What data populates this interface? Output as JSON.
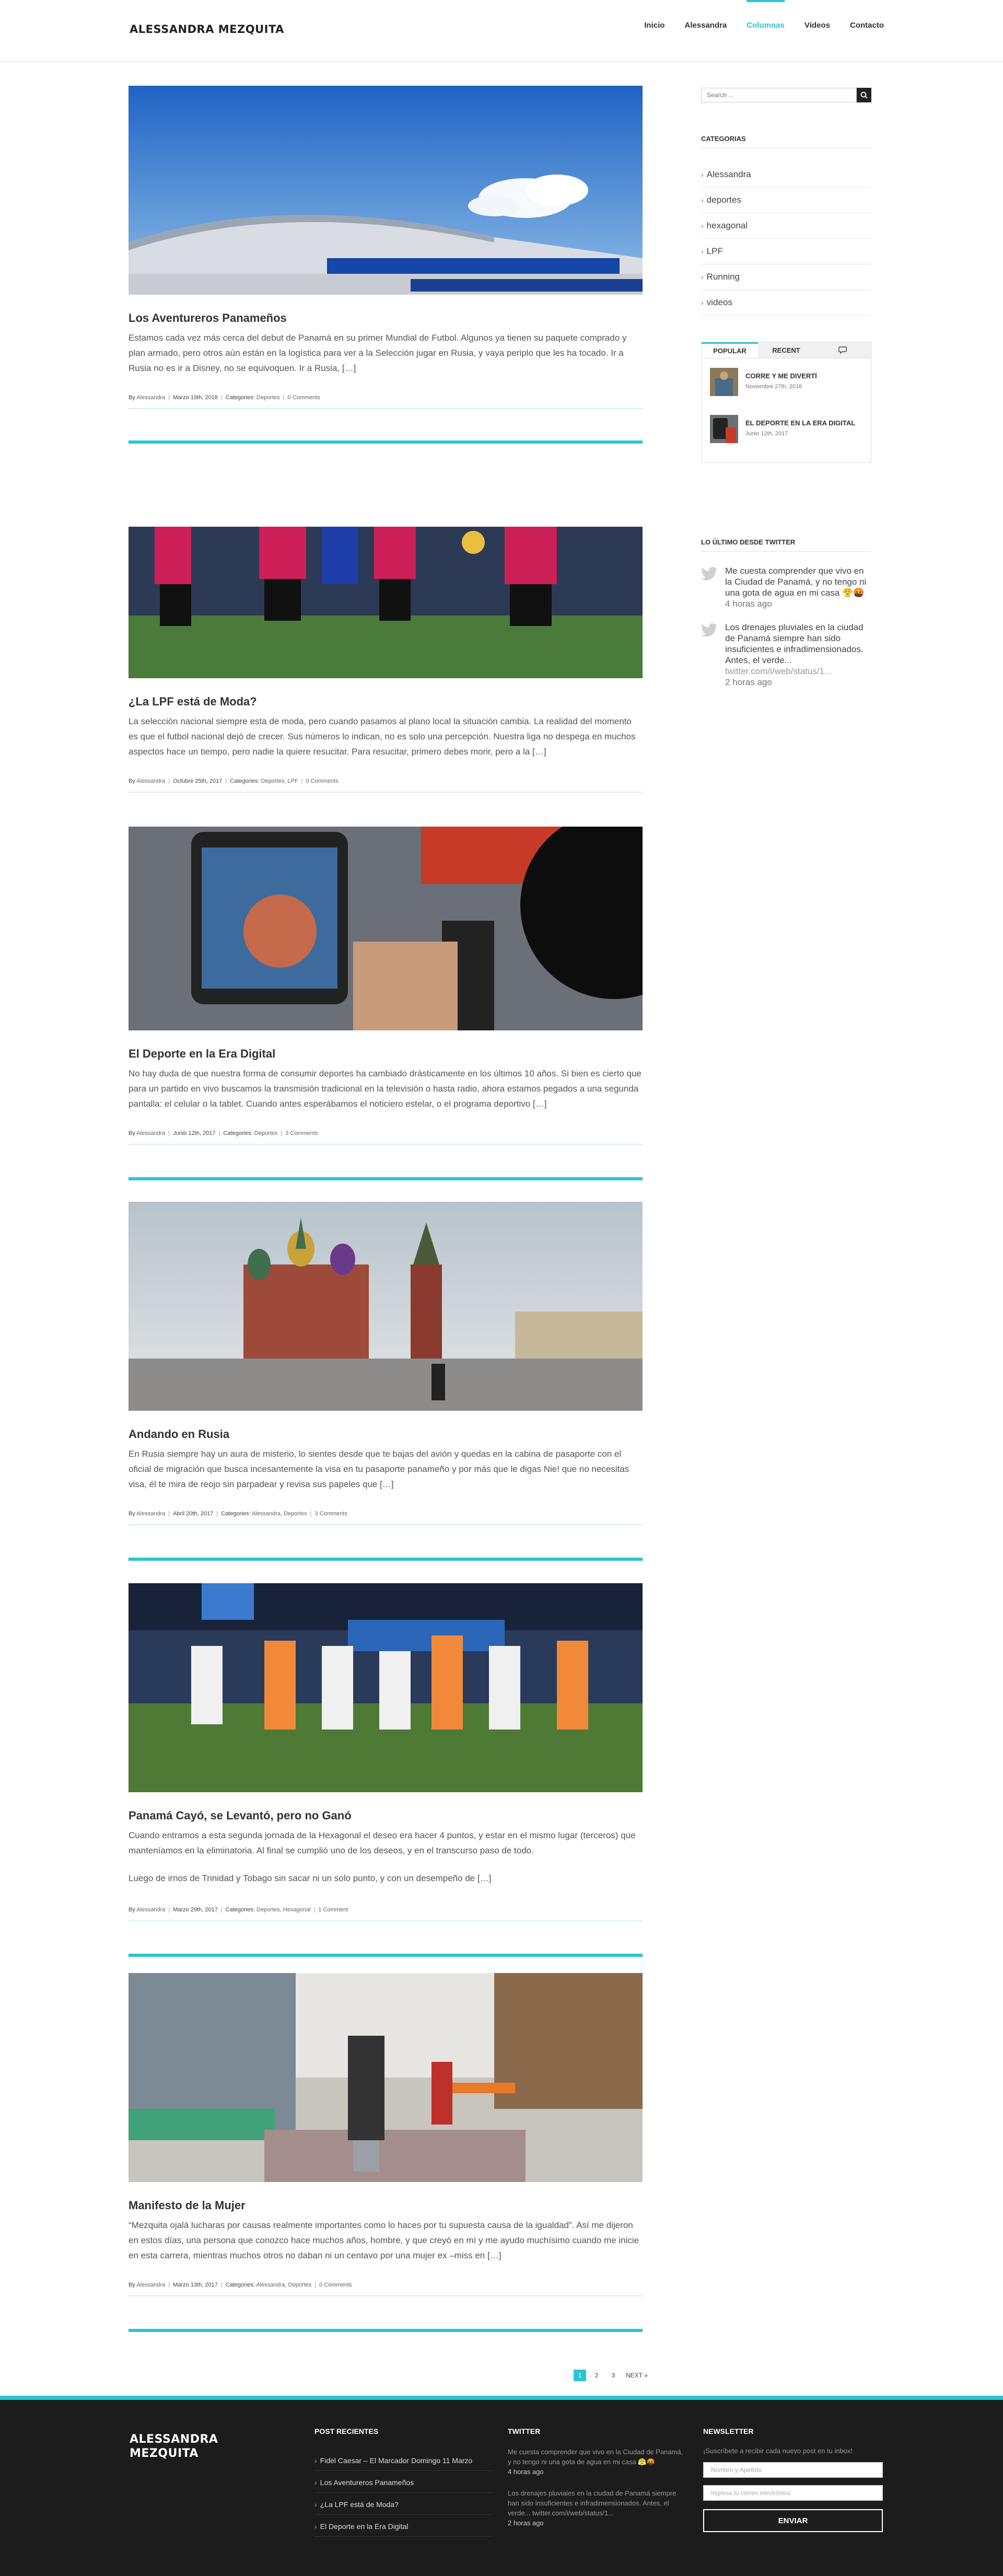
{
  "header": {
    "logo": "ALESSANDRA MEZQUITA",
    "nav": [
      "Inicio",
      "Alessandra",
      "Columnas",
      "Vídeos",
      "Contacto"
    ],
    "active_nav": "Columnas"
  },
  "posts": [
    {
      "title": "Los Aventureros Panameños",
      "excerpt": "Estamos cada vez más cerca del debut de Panamá en su primer Mundial de Futbol. Algunos ya tienen su paquete comprado y plan armado, pero otros aún están en la logística para ver a la Selección jugar en Rusia, y vaya periplo que les ha tocado. Ir a Rusia no es ir a Disney, no se equivoquen. Ir a Rusia, […]",
      "excerpt_extra": "",
      "author": "Alessandra",
      "date": "Marzo 19th, 2018",
      "categories": "Deportes",
      "comments": "0 Comments",
      "image_desc": "estadio-confederaciones"
    },
    {
      "title": "¿La LPF está de Moda?",
      "excerpt": "La selección nacional siempre esta de moda, pero cuando pasamos al plano local la situación cambia. La realidad del momento es que el futbol nacional dejó de crecer. Sus números lo indican, no es solo una percepción. Nuestra liga no despega en muchos aspectos hace un tiempo, pero nadie la quiere resucitar. Para resucitar, primero debes morir, pero a la […]",
      "excerpt_extra": "",
      "author": "Alessandra",
      "date": "Octubre 25th, 2017",
      "categories": "Deportes, LPF",
      "comments": "0 Comments",
      "image_desc": "arbitros-cancha"
    },
    {
      "title": "El Deporte en la Era Digital",
      "excerpt": "No hay duda de que nuestra forma de consumir deportes ha cambiado drásticamente en los últimos 10 años. Si bien es cierto que para un partido en vivo buscamos la transmisión tradicional en la televisión o hasta radio, ahora estamos pegados a una segunda pantalla: el celular o la tablet. Cuando antes esperábamos el noticiero estelar, o el programa deportivo […]",
      "excerpt_extra": "",
      "author": "Alessandra",
      "date": "Junio 12th, 2017",
      "categories": "Deportes",
      "comments": "3 Comments",
      "image_desc": "celular-prensa"
    },
    {
      "title": "Andando en Rusia",
      "excerpt": "En Rusia siempre hay un aura de misterio, lo sientes desde que te bajas del avión y quedas en la cabina de pasaporte con el oficial de migración que busca incesantemente la visa en tu pasaporte panameño y por más que le digas Nie! que no necesitas visa, él te mira de reojo sin parpadear y revisa sus papeles que […]",
      "excerpt_extra": "",
      "author": "Alessandra",
      "date": "Abril 20th, 2017",
      "categories": "Alessandra, Deportes",
      "comments": "3 Comments",
      "image_desc": "plaza-roja"
    },
    {
      "title": "Panamá Cayó, se Levantó, pero no Ganó",
      "excerpt": "Cuando entramos a esta segunda jornada de la Hexagonal el deseo era hacer 4 puntos, y estar en el mismo lugar (terceros) que manteníamos en la eliminatoria. Al final se cumplió uno de los deseos, y en el transcurso paso de todo.",
      "excerpt_extra": "Luego de irnos de Trinidad y Tobago sin sacar ni un solo punto, y con un desempeño de […]",
      "author": "Alessandra",
      "date": "Marzo 29th, 2017",
      "categories": "Deportes, Hexagonal",
      "comments": "1 Comment",
      "image_desc": "jugadores-entrenamiento"
    },
    {
      "title": "Manifesto de la Mujer",
      "excerpt": "“Mezquita ojalá lucharas por causas realmente importantes como lo haces por tu supuesta causa de la igualdad”. Así me dijeron en estos días, una persona que conozco hace muchos años, hombre, y que creyó en mí y me ayudo muchísimo cuando me inicie en esta carrera, mientras muchos otros no daban ni un centavo por una mujer ex –miss en […]",
      "excerpt_extra": "",
      "author": "Alessandra",
      "date": "Marzo 13th, 2017",
      "categories": "Alessandra, Deportes",
      "comments": "0 Comments",
      "image_desc": "mujer-calle"
    }
  ],
  "meta_labels": {
    "by": "By"
  },
  "sidebar": {
    "search_placeholder": "Search ...",
    "categories_title": "CATEGORIAS",
    "categories": [
      "Alessandra",
      "deportes",
      "hexagonal",
      "LPF",
      "Running",
      "videos"
    ],
    "tabs": [
      "POPULAR",
      "RECENT"
    ],
    "popular": [
      {
        "title": "CORRE Y ME DIVERTÍ",
        "date": "Noviembre 27th, 2016"
      },
      {
        "title": "EL DEPORTE EN LA ERA DIGITAL",
        "date": "Junio 12th, 2017"
      }
    ],
    "twitter_title": "LO ÚLTIMO DESDE TWITTER",
    "tweets": [
      {
        "text": "Me cuesta comprender que vivo en la Ciudad de Panamá, y no tengo ni una gota de agua en mi casa 😤🤬",
        "link": "",
        "time": "4 horas ago"
      },
      {
        "text": "Los drenajes pluviales en la ciudad de Panamá siempre han sido insuficientes e infradimensionados. Antes, el verde...",
        "link": "twitter.com/i/web/status/1...",
        "time": "2 horas ago"
      }
    ]
  },
  "pagination": {
    "pages": [
      "1",
      "2",
      "3"
    ],
    "current": "1",
    "next": "NEXT »"
  },
  "footer": {
    "logo_line1": "ALESSANDRA",
    "logo_line2": "MEZQUITA",
    "recent_title": "POST RECIENTES",
    "recent": [
      "Fidel Caesar – El Marcador Domingo 11 Marzo",
      "Los Aventureros Panameños",
      "¿La LPF está de Moda?",
      "El Deporte en la Era Digital"
    ],
    "twitter_title": "TWITTER",
    "tweets": [
      {
        "text": "Me cuesta comprender que vivo en la Ciudad de Panamá, y no tengo ni una gota de agua en mi casa 😤🤬",
        "time": "4 horas ago"
      },
      {
        "text": "Los drenajes pluviales en la ciudad de Panamá siempre han sido insuficientes e infradimensionados. Antes, el verde... twitter.com/i/web/status/1...",
        "time": "2 horas ago"
      }
    ],
    "newsletter_title": "NEWSLETTER",
    "newsletter_text": "¡Suscríbete a recibir cada nuevo post en tu inbox!",
    "name_placeholder": "Nombre y Apellido",
    "email_placeholder": "Ingresa tu correo electrónico",
    "submit": "ENVIAR"
  },
  "colors": {
    "accent": "#2bc5d4",
    "footer_bg": "#1c1c1c"
  }
}
